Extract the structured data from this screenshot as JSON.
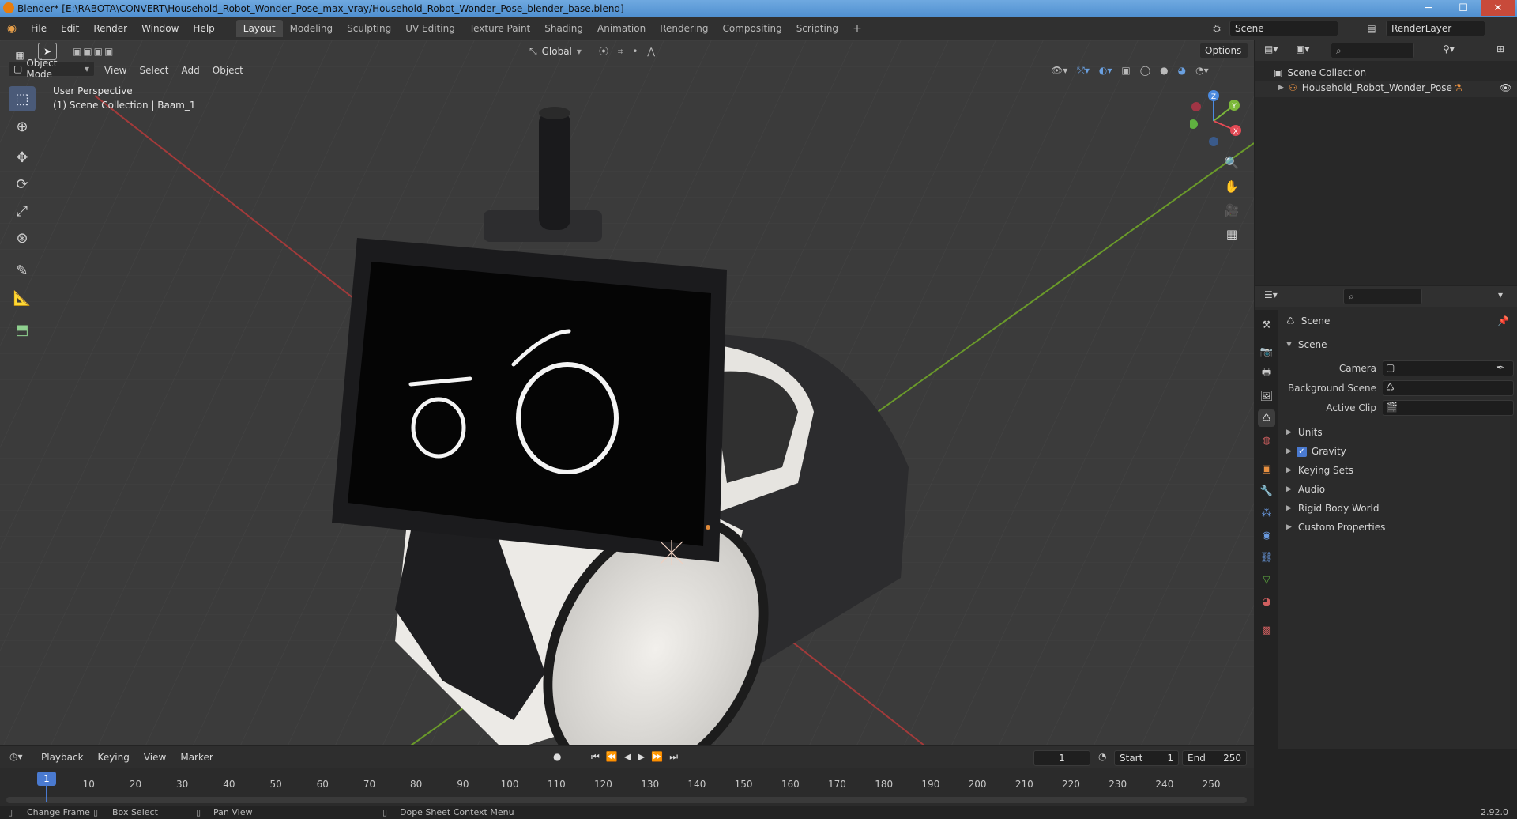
{
  "window": {
    "title": "Blender* [E:\\RABOTA\\CONVERT\\Household_Robot_Wonder_Pose_max_vray/Household_Robot_Wonder_Pose_blender_base.blend]",
    "minimize": "─",
    "maximize": "☐",
    "close": "✕"
  },
  "menu": [
    "File",
    "Edit",
    "Render",
    "Window",
    "Help"
  ],
  "workspaces": [
    "Layout",
    "Modeling",
    "Sculpting",
    "UV Editing",
    "Texture Paint",
    "Shading",
    "Animation",
    "Rendering",
    "Compositing",
    "Scripting"
  ],
  "active_workspace": "Layout",
  "scene_field": "Scene",
  "renderlayer_field": "RenderLayer",
  "viewport": {
    "transform_orientation": "Global",
    "options_label": "Options",
    "mode": "Object Mode",
    "header_menus": [
      "View",
      "Select",
      "Add",
      "Object"
    ],
    "overlay_line1": "User Perspective",
    "overlay_line2": "(1) Scene Collection | Baam_1",
    "gizmo_axes": {
      "z": "Z",
      "y": "Y",
      "x": "X"
    }
  },
  "outliner": {
    "root": "Scene Collection",
    "item": "Household_Robot_Wonder_Pose"
  },
  "properties": {
    "context_title": "Scene",
    "panel_title": "Scene",
    "fields": [
      {
        "label": "Camera"
      },
      {
        "label": "Background Scene"
      },
      {
        "label": "Active Clip"
      }
    ],
    "subpanels": [
      "Units",
      "Gravity",
      "Keying Sets",
      "Audio",
      "Rigid Body World",
      "Custom Properties"
    ],
    "gravity_checked": true
  },
  "timeline": {
    "menus": [
      "Playback",
      "Keying",
      "View",
      "Marker"
    ],
    "current_frame": "1",
    "start_label": "Start",
    "start_value": "1",
    "end_label": "End",
    "end_value": "250",
    "ticks": [
      "10",
      "20",
      "30",
      "40",
      "50",
      "60",
      "70",
      "80",
      "90",
      "100",
      "110",
      "120",
      "130",
      "140",
      "150",
      "160",
      "170",
      "180",
      "190",
      "200",
      "210",
      "220",
      "230",
      "240",
      "250"
    ],
    "playhead": "1"
  },
  "status": {
    "items": [
      "Change Frame",
      "Box Select",
      "Pan View",
      "Dope Sheet Context Menu"
    ],
    "version": "2.92.0"
  }
}
